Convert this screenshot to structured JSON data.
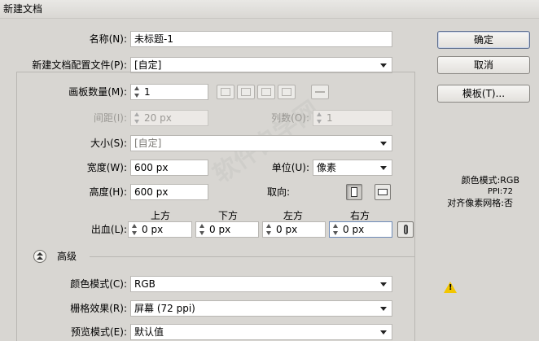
{
  "window": {
    "title": "新建文档"
  },
  "name": {
    "label": "名称(N):",
    "value": "未标题-1"
  },
  "profile": {
    "label": "新建文档配置文件(P):",
    "value": "[自定]"
  },
  "artboards": {
    "label": "画板数量(M):",
    "value": "1"
  },
  "spacing": {
    "label": "间距(I):",
    "value": "20 px"
  },
  "columns": {
    "label": "列数(O):",
    "value": "1"
  },
  "size": {
    "label": "大小(S):",
    "value": "[自定]"
  },
  "width": {
    "label": "宽度(W):",
    "value": "600 px"
  },
  "units": {
    "label": "单位(U):",
    "value": "像素"
  },
  "height": {
    "label": "高度(H):",
    "value": "600 px"
  },
  "orientation": {
    "label": "取向:"
  },
  "bleed": {
    "label": "出血(L):",
    "top": {
      "label": "上方",
      "value": "0 px"
    },
    "bottom": {
      "label": "下方",
      "value": "0 px"
    },
    "left": {
      "label": "左方",
      "value": "0 px"
    },
    "right": {
      "label": "右方",
      "value": "0 px"
    }
  },
  "advanced": {
    "label": "高级"
  },
  "color_mode": {
    "label": "颜色模式(C):",
    "value": "RGB"
  },
  "raster": {
    "label": "栅格效果(R):",
    "value": "屏幕 (72 ppi)"
  },
  "preview": {
    "label": "预览模式(E):",
    "value": "默认值"
  },
  "buttons": {
    "ok": "确定",
    "cancel": "取消",
    "templates": "模板(T)..."
  },
  "info": {
    "color_mode": "颜色模式:RGB",
    "ppi": "PPI:72",
    "align": "对齐像素网格:否"
  },
  "colors": {
    "dialog_bg": "#d8d6d2",
    "field_border": "#b9b7b3",
    "warning": "#f2c600"
  }
}
